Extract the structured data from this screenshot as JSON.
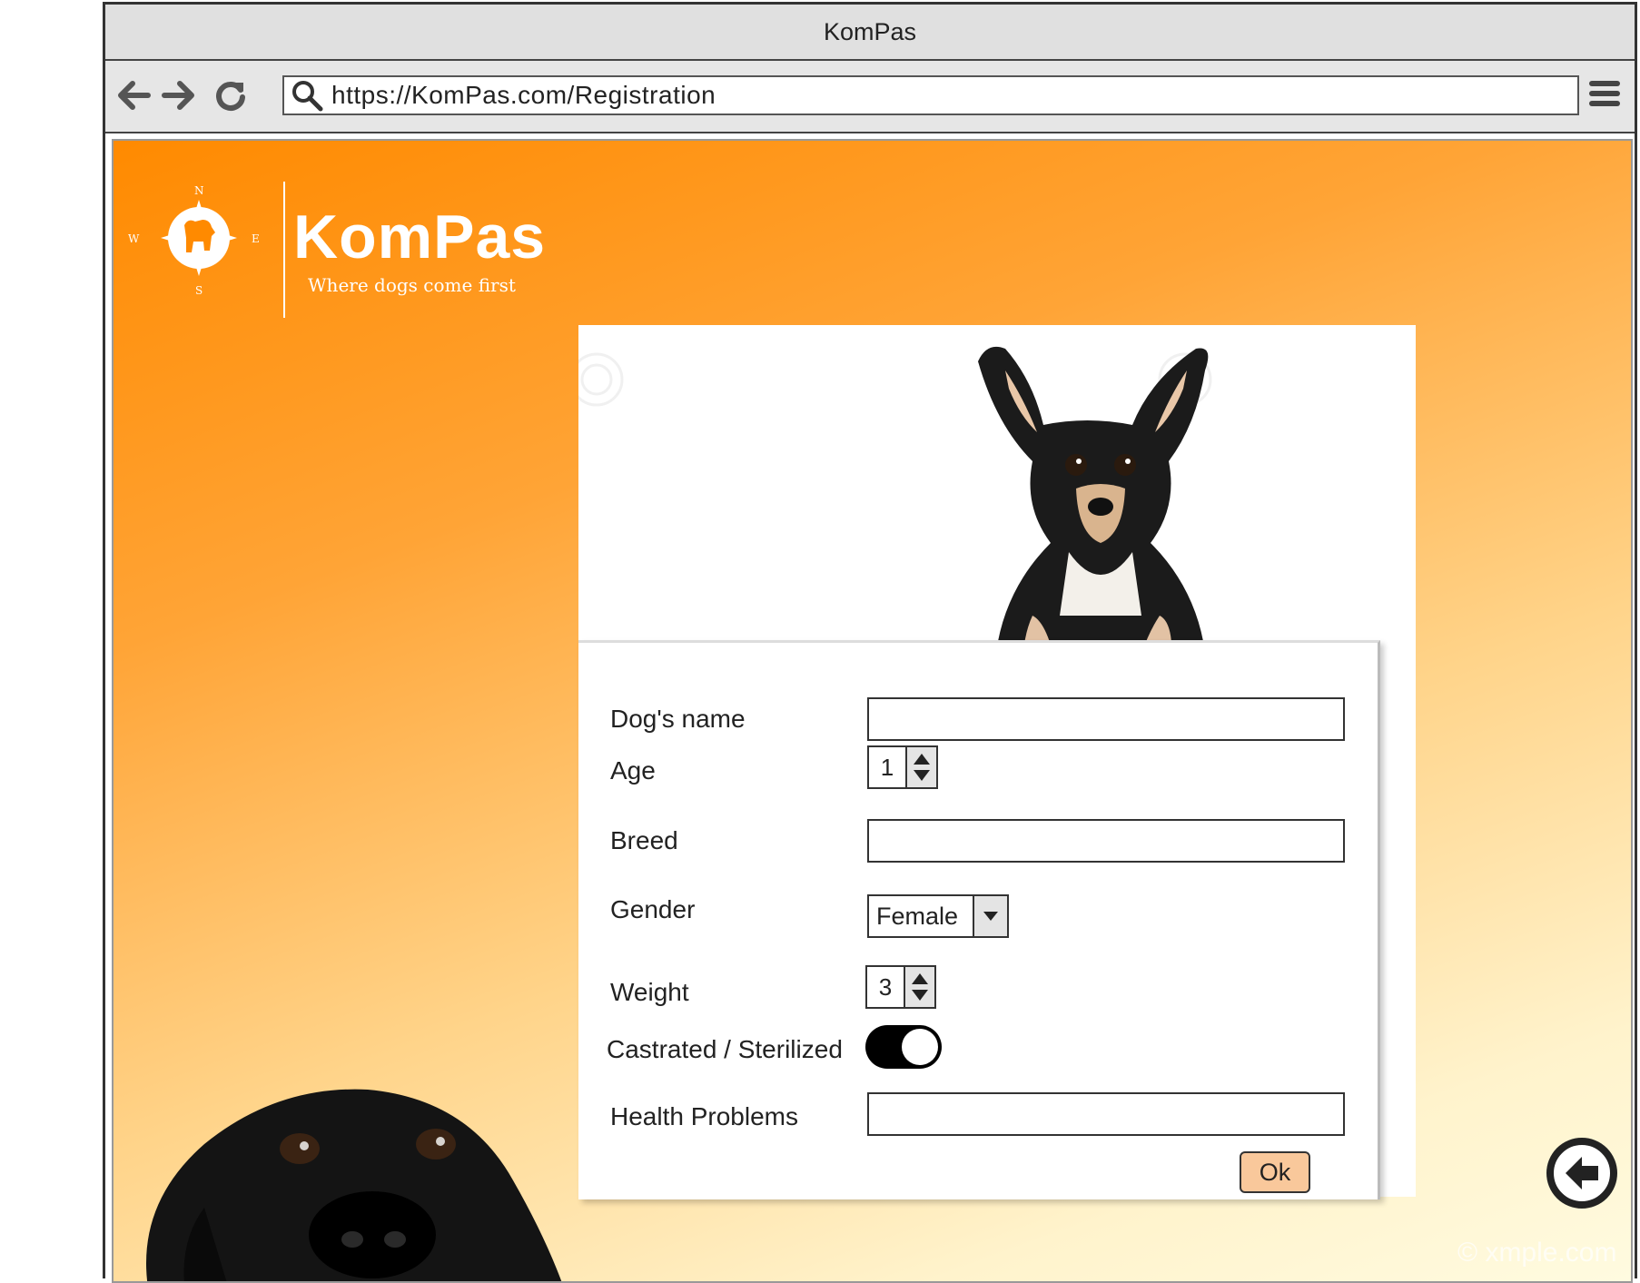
{
  "window": {
    "title": "KomPas"
  },
  "toolbar": {
    "url": "https://KomPas.com/Registration",
    "back_icon": "arrow-left-icon",
    "forward_icon": "arrow-right-icon",
    "reload_icon": "reload-icon",
    "menu_icon": "hamburger-menu-icon"
  },
  "brand": {
    "name": "KomPas",
    "tagline": "Where dogs come first",
    "compass": {
      "n": "N",
      "s": "S",
      "e": "E",
      "w": "W"
    }
  },
  "form": {
    "name_label": "Dog's name",
    "name_value": "",
    "age_label": "Age",
    "age_value": "1",
    "breed_label": "Breed",
    "breed_value": "",
    "gender_label": "Gender",
    "gender_value": "Female",
    "weight_label": "Weight",
    "weight_value": "3",
    "castrated_label": "Castrated / Sterilized",
    "castrated_on": true,
    "health_label": "Health Problems",
    "health_value": "",
    "ok_label": "Ok"
  },
  "footer": {
    "watermark": "© xmple.com"
  },
  "colors": {
    "accent": "#ff8a00",
    "ok_button": "#f9c89b"
  }
}
